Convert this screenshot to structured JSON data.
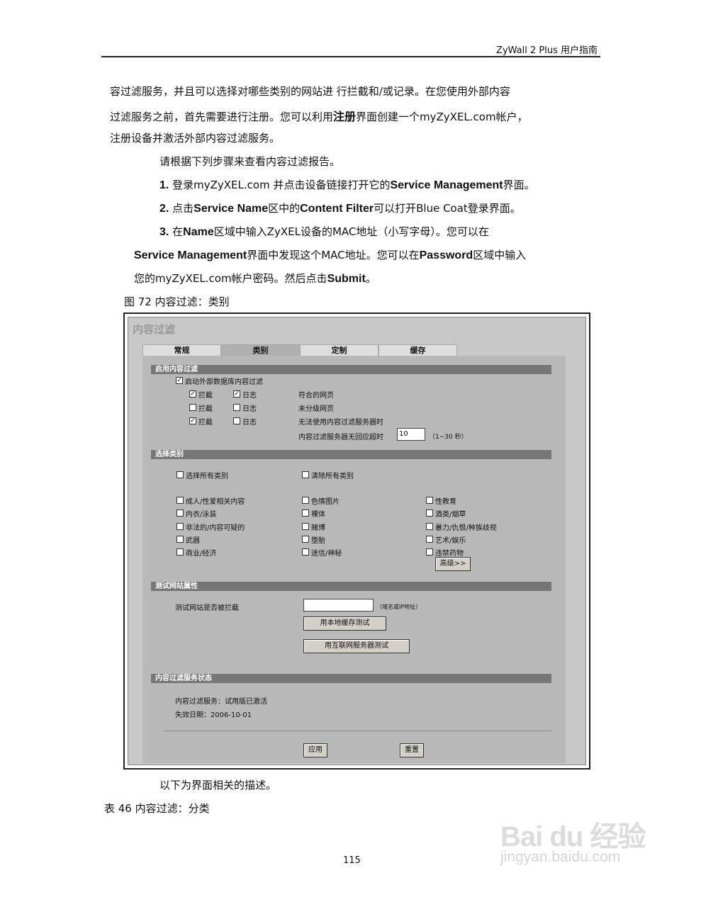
{
  "header": {
    "title": "ZyWall 2 Plus  用户指南"
  },
  "intro": {
    "line1": "容过滤服务，并且可以选择对哪些类别的网站进  行拦截和/或记录。在您使用外部内容",
    "line2a": "过滤服务之前，首先需要进行注册。您可以利用",
    "line2b": "注册",
    "line2c": "界面创建一个myZyXEL.com帐户，",
    "line3": "注册设备并激活外部内容过滤服务。"
  },
  "lead": "请根据下列步骤来查看内容过滤报告。",
  "steps": {
    "s1": {
      "num": "1.",
      "a": "登录myZyXEL.com   并点击设备链接打开它的",
      "b": "Service Management",
      "c": "界面。"
    },
    "s2": {
      "num": "2.",
      "a": "点击",
      "b": "Service Name",
      "c": "区中的",
      "d": "Content Filter",
      "e": "可以打开Blue Coat登录界面。"
    },
    "s3": {
      "num": "3.",
      "a": "在",
      "b": "Name",
      "c": "区域中输入ZyXEL设备的MAC地址（小写字母）。您可以在",
      "d": "Service Management",
      "e": "界面中发现这个MAC地址。您可以在",
      "f": "Password",
      "g": "区域中输入",
      "h": "您的myZyXEL.com帐户密码。然后点击",
      "i": "Submit",
      "j": "。"
    }
  },
  "figure_caption": "图  72   内容过滤：类别",
  "panel": {
    "title": "内容过滤",
    "tabs": [
      "常规",
      "类别",
      "定制",
      "缓存"
    ],
    "sections": {
      "enable": "启用内容过滤",
      "select": "选择类别",
      "test": "测试网站属性",
      "status": "内容过滤服务状态"
    },
    "enable_external": "启动外部数据库内容过滤",
    "block": "拦截",
    "log": "日志",
    "row_labels": [
      "符合的网页",
      "未分级网页",
      "无法使用内容过滤服务器时"
    ],
    "timeout_label": "内容过滤服务器无回应超时",
    "timeout_value": "10",
    "timeout_range": "（1~30 秒）",
    "select_all": "选择所有类别",
    "clear_all": "清除所有类别",
    "categories": [
      "成人/性爱相关内容",
      "色情图片",
      "性教育",
      "内衣/泳装",
      "裸体",
      "酒类/烟草",
      "非法的/内容可疑的",
      "赌博",
      "暴力/仇恨/种族歧视",
      "武器",
      "堕胎",
      "艺术/娱乐",
      "商业/经济",
      "迷信/神秘",
      "违禁药物"
    ],
    "advanced_button": "高级>>",
    "test_label": "测试网站是否被拦截",
    "test_hint": "（域名或IP地址）",
    "local_cache_button": "用本地缓存测试",
    "internet_server_button": "用互联网服务器测试",
    "service_status": "内容过滤服务：试用版已激活",
    "expiry_label": "失效日期：",
    "expiry_date": "2006-10-01",
    "apply_button": "应用",
    "reset_button": "重置"
  },
  "after_text": "以下为界面相关的描述。",
  "table_caption": "表  46   内容过滤：分类",
  "page_number": "115",
  "watermark": {
    "logo": "Bai du 经验",
    "url": "jingyan.baidu.com"
  }
}
